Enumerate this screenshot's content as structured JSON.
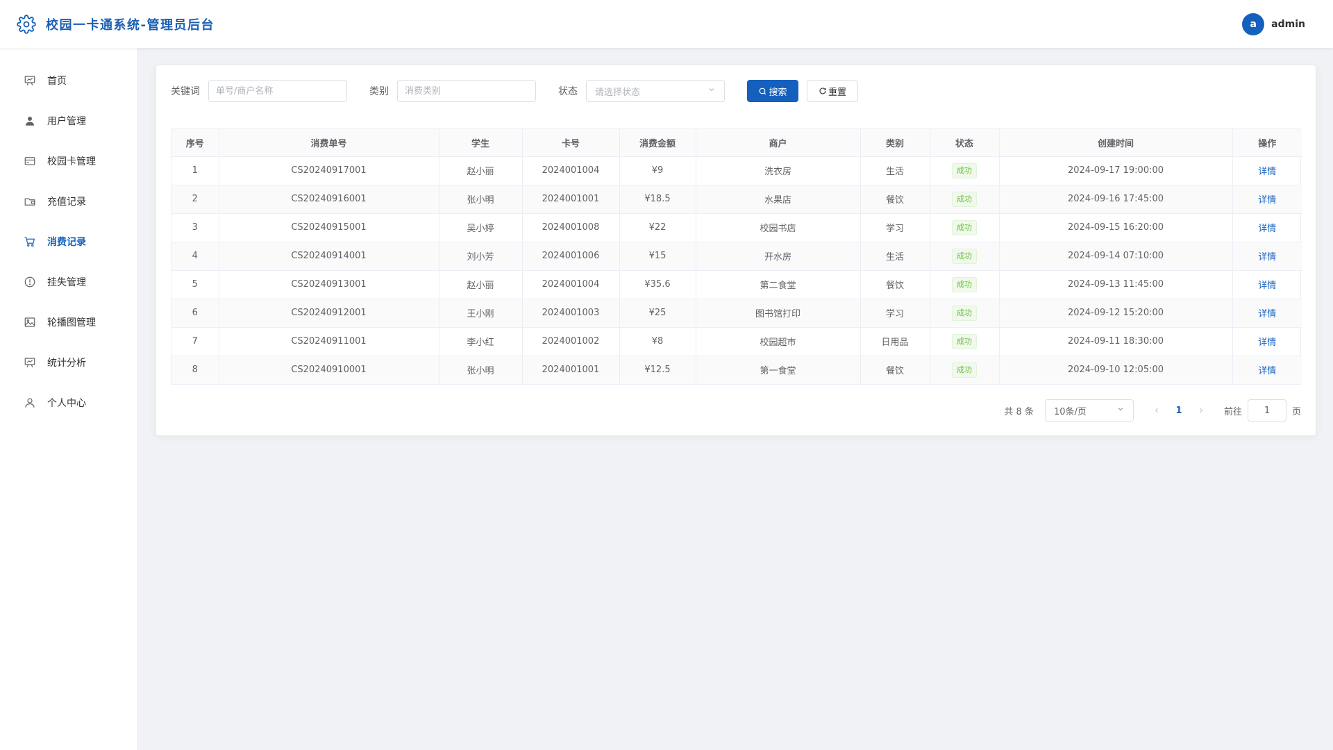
{
  "header": {
    "title": "校园一卡通系统-管理员后台",
    "avatar_letter": "a",
    "username": "admin"
  },
  "sidebar": {
    "items": [
      {
        "label": "首页",
        "icon": "chart-icon"
      },
      {
        "label": "用户管理",
        "icon": "user-icon"
      },
      {
        "label": "校园卡管理",
        "icon": "card-icon"
      },
      {
        "label": "充值记录",
        "icon": "wallet-icon"
      },
      {
        "label": "消费记录",
        "icon": "cart-icon",
        "active": true
      },
      {
        "label": "挂失管理",
        "icon": "warning-icon"
      },
      {
        "label": "轮播图管理",
        "icon": "picture-icon"
      },
      {
        "label": "统计分析",
        "icon": "chart-icon"
      },
      {
        "label": "个人中心",
        "icon": "user-outline-icon"
      }
    ]
  },
  "search": {
    "keyword_label": "关键词",
    "keyword_placeholder": "单号/商户名称",
    "category_label": "类别",
    "category_placeholder": "消费类别",
    "status_label": "状态",
    "status_placeholder": "请选择状态",
    "search_button": "搜索",
    "reset_button": "重置"
  },
  "table": {
    "columns": [
      "序号",
      "消费单号",
      "学生",
      "卡号",
      "消费金额",
      "商户",
      "类别",
      "状态",
      "创建时间",
      "操作"
    ],
    "rows": [
      {
        "index": "1",
        "order": "CS20240917001",
        "student": "赵小丽",
        "card": "2024001004",
        "amount": "¥9",
        "merchant": "洗衣房",
        "category": "生活",
        "status": "成功",
        "time": "2024-09-17 19:00:00",
        "action": "详情"
      },
      {
        "index": "2",
        "order": "CS20240916001",
        "student": "张小明",
        "card": "2024001001",
        "amount": "¥18.5",
        "merchant": "水果店",
        "category": "餐饮",
        "status": "成功",
        "time": "2024-09-16 17:45:00",
        "action": "详情"
      },
      {
        "index": "3",
        "order": "CS20240915001",
        "student": "吴小婷",
        "card": "2024001008",
        "amount": "¥22",
        "merchant": "校园书店",
        "category": "学习",
        "status": "成功",
        "time": "2024-09-15 16:20:00",
        "action": "详情"
      },
      {
        "index": "4",
        "order": "CS20240914001",
        "student": "刘小芳",
        "card": "2024001006",
        "amount": "¥15",
        "merchant": "开水房",
        "category": "生活",
        "status": "成功",
        "time": "2024-09-14 07:10:00",
        "action": "详情"
      },
      {
        "index": "5",
        "order": "CS20240913001",
        "student": "赵小丽",
        "card": "2024001004",
        "amount": "¥35.6",
        "merchant": "第二食堂",
        "category": "餐饮",
        "status": "成功",
        "time": "2024-09-13 11:45:00",
        "action": "详情"
      },
      {
        "index": "6",
        "order": "CS20240912001",
        "student": "王小刚",
        "card": "2024001003",
        "amount": "¥25",
        "merchant": "图书馆打印",
        "category": "学习",
        "status": "成功",
        "time": "2024-09-12 15:20:00",
        "action": "详情"
      },
      {
        "index": "7",
        "order": "CS20240911001",
        "student": "李小红",
        "card": "2024001002",
        "amount": "¥8",
        "merchant": "校园超市",
        "category": "日用品",
        "status": "成功",
        "time": "2024-09-11 18:30:00",
        "action": "详情"
      },
      {
        "index": "8",
        "order": "CS20240910001",
        "student": "张小明",
        "card": "2024001001",
        "amount": "¥12.5",
        "merchant": "第一食堂",
        "category": "餐饮",
        "status": "成功",
        "time": "2024-09-10 12:05:00",
        "action": "详情"
      }
    ]
  },
  "pagination": {
    "total_text": "共 8 条",
    "page_size": "10条/页",
    "current_page": "1",
    "goto_label": "前往",
    "goto_value": "1",
    "page_suffix": "页"
  },
  "colors": {
    "accent": "#1560bd",
    "success": "#67c23a",
    "background": "#f0f2f5"
  }
}
